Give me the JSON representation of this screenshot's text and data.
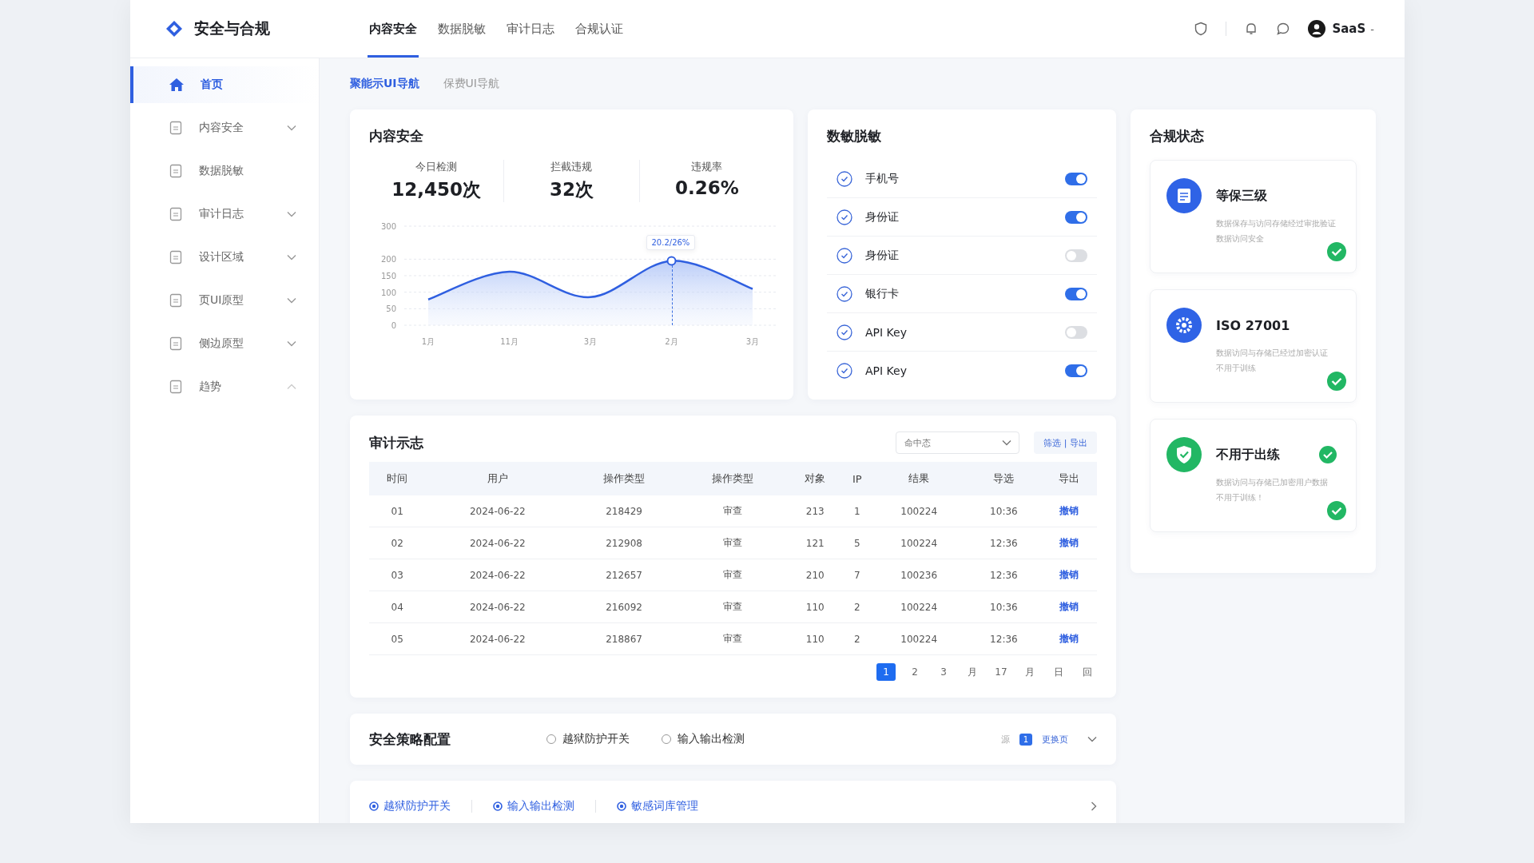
{
  "brand": {
    "name": "安全与合规"
  },
  "top_tabs": [
    {
      "label": "内容安全",
      "selected": true
    },
    {
      "label": "数据脱敏",
      "selected": false
    },
    {
      "label": "审计日志",
      "selected": false
    },
    {
      "label": "合规认证",
      "selected": false
    }
  ],
  "user": {
    "name": "SaaS",
    "caret": "-"
  },
  "sub_tabs": [
    {
      "label": "聚能示UI导航",
      "selected": true
    },
    {
      "label": "保费UI导航",
      "selected": false
    }
  ],
  "sidebar": {
    "items": [
      {
        "label": "首页",
        "kind": "link",
        "selected": true
      },
      {
        "label": "内容安全",
        "kind": "group",
        "selected": false,
        "expanded": false
      },
      {
        "label": "数据脱敏",
        "kind": "link",
        "selected": false
      },
      {
        "label": "审计日志",
        "kind": "group",
        "selected": false,
        "expanded": false
      },
      {
        "label": "设计区域",
        "kind": "group",
        "selected": false,
        "expanded": false
      },
      {
        "label": "页UI原型",
        "kind": "group",
        "selected": false,
        "expanded": false
      },
      {
        "label": "侧边原型",
        "kind": "group",
        "selected": false,
        "expanded": false
      },
      {
        "label": "趋势",
        "kind": "group",
        "selected": false,
        "expanded": true
      }
    ]
  },
  "content_card": {
    "title": "内容安全",
    "stats": [
      {
        "label": "今日检测",
        "value": "12,450次"
      },
      {
        "label": "拦截违规",
        "value": "32次"
      },
      {
        "label": "违规率",
        "value": "0.26%"
      }
    ],
    "chart_data": {
      "type": "area",
      "categories": [
        "1月",
        "11月",
        "3月",
        "2月",
        "3月"
      ],
      "series": [
        {
          "color": "#2f5fe0",
          "values": [
            78,
            162,
            85,
            195,
            110
          ]
        }
      ],
      "ylim": [
        0,
        300
      ],
      "yticks": [
        0,
        50,
        100,
        150,
        200,
        300
      ],
      "grid": true,
      "annotations": [
        "20.2/26%"
      ]
    }
  },
  "masking_card": {
    "title": "数敏脱敏",
    "items": [
      {
        "label": "手机号",
        "on": true
      },
      {
        "label": "身份证",
        "on": true
      },
      {
        "label": "身份证",
        "on": false
      },
      {
        "label": "银行卡",
        "on": true
      },
      {
        "label": "API Key",
        "on": false
      },
      {
        "label": "API Key",
        "on": true
      }
    ]
  },
  "compliance": {
    "title": "合规状态",
    "cards": [
      {
        "kind": "doc",
        "title": "等保三级",
        "lines": [
          "数据保存与访问存储经过审批验证",
          "数据访问安全"
        ],
        "title_check": false,
        "verified": true
      },
      {
        "kind": "gear",
        "title": "ISO 27001",
        "lines": [
          "数据访问与存储已经过加密认证",
          "不用于训练"
        ],
        "title_check": false,
        "verified": true
      },
      {
        "kind": "shield",
        "title": "不用于出练",
        "lines": [
          "数据访问与存储已加密用户数据",
          "不用于训练！"
        ],
        "title_check": true,
        "verified": true
      }
    ]
  },
  "audit": {
    "title": "审计示志",
    "select": {
      "placeholder": "命中态"
    },
    "filter_button": "筛选 | 导出",
    "columns": [
      "时间",
      "用户",
      "操作类型",
      "操作类型",
      "对象",
      "IP",
      "结果",
      "导选",
      "导出"
    ],
    "rows": [
      [
        "01",
        "2024-06-22",
        "218429",
        "审查",
        "213",
        "1",
        "100224",
        "10:36",
        "撤销"
      ],
      [
        "02",
        "2024-06-22",
        "212908",
        "审查",
        "121",
        "5",
        "100224",
        "12:36",
        "撤销"
      ],
      [
        "03",
        "2024-06-22",
        "212657",
        "审查",
        "210",
        "7",
        "100236",
        "12:36",
        "撤销"
      ],
      [
        "04",
        "2024-06-22",
        "216092",
        "审查",
        "110",
        "2",
        "100224",
        "10:36",
        "撤销"
      ],
      [
        "05",
        "2024-06-22",
        "218867",
        "审查",
        "110",
        "2",
        "100224",
        "12:36",
        "撤销"
      ]
    ],
    "pages": [
      {
        "label": "1",
        "selected": true
      },
      {
        "label": "2",
        "selected": false
      },
      {
        "label": "3",
        "selected": false
      },
      {
        "label": "月",
        "selected": false
      },
      {
        "label": "17",
        "selected": false
      },
      {
        "label": "月",
        "selected": false
      },
      {
        "label": "日",
        "selected": false
      },
      {
        "label": "回",
        "selected": false
      }
    ]
  },
  "policy": {
    "title": "安全策略配置",
    "options": [
      {
        "label": "越狱防护开关",
        "selected": false
      },
      {
        "label": "输入输出检测",
        "selected": false
      }
    ],
    "source_label": "源",
    "badge": "1",
    "more": "更换页"
  },
  "quick_links": [
    {
      "label": "越狱防护开关"
    },
    {
      "label": "输入输出检测"
    },
    {
      "label": "敏感词库管理"
    }
  ]
}
